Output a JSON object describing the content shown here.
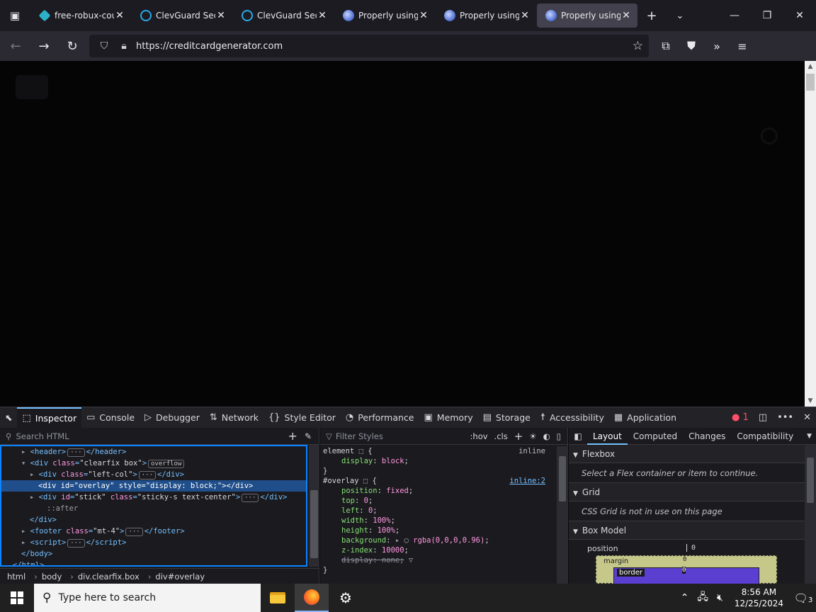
{
  "tabs": [
    {
      "title": "free-robux-cou",
      "favicon": "robux",
      "active": false
    },
    {
      "title": "ClevGuard Secu",
      "favicon": "guard",
      "active": false
    },
    {
      "title": "ClevGuard Secu",
      "favicon": "guard",
      "active": false
    },
    {
      "title": "Properly using",
      "favicon": "prop",
      "active": false
    },
    {
      "title": "Properly using",
      "favicon": "prop",
      "active": false
    },
    {
      "title": "Properly using",
      "favicon": "prop",
      "active": true
    }
  ],
  "urlbar": {
    "url": "https://creditcardgenerator.com"
  },
  "devtools": {
    "tabs": [
      {
        "label": "Inspector",
        "icon": "inspector-icon",
        "glyph": "⬚",
        "active": true
      },
      {
        "label": "Console",
        "icon": "console-icon",
        "glyph": "▭"
      },
      {
        "label": "Debugger",
        "icon": "debugger-icon",
        "glyph": "▷"
      },
      {
        "label": "Network",
        "icon": "network-icon",
        "glyph": "⇅"
      },
      {
        "label": "Style Editor",
        "icon": "style-editor-icon",
        "glyph": "{}"
      },
      {
        "label": "Performance",
        "icon": "performance-icon",
        "glyph": "◔"
      },
      {
        "label": "Memory",
        "icon": "memory-icon",
        "glyph": "▣"
      },
      {
        "label": "Storage",
        "icon": "storage-icon",
        "glyph": "▤"
      },
      {
        "label": "Accessibility",
        "icon": "accessibility-icon",
        "glyph": "☨"
      },
      {
        "label": "Application",
        "icon": "application-icon",
        "glyph": "▦"
      }
    ],
    "error_count": "1",
    "inspector": {
      "search_placeholder": "Search HTML",
      "breadcrumbs": [
        "html",
        "body",
        "div.clearfix.box",
        "div#overlay"
      ]
    },
    "rules": {
      "filter_placeholder": "Filter Styles",
      "hov": ":hov",
      "cls": ".cls",
      "element_selector": "element",
      "element_source": "inline",
      "overlay_selector": "#overlay",
      "overlay_source": "inline:2"
    },
    "layout": {
      "tabs": [
        "Layout",
        "Computed",
        "Changes",
        "Compatibility"
      ],
      "flexbox_title": "Flexbox",
      "flexbox_msg": "Select a Flex container or item to continue.",
      "grid_title": "Grid",
      "grid_msg": "CSS Grid is not in use on this page",
      "boxmodel_title": "Box Model",
      "position_label": "position",
      "position_value": "0",
      "margin_label": "margin",
      "margin_value": "0",
      "border_label": "border",
      "border_value": "0"
    }
  },
  "taskbar": {
    "search_placeholder": "Type here to search",
    "time": "8:56 AM",
    "date": "12/25/2024",
    "notif_count": "3"
  }
}
